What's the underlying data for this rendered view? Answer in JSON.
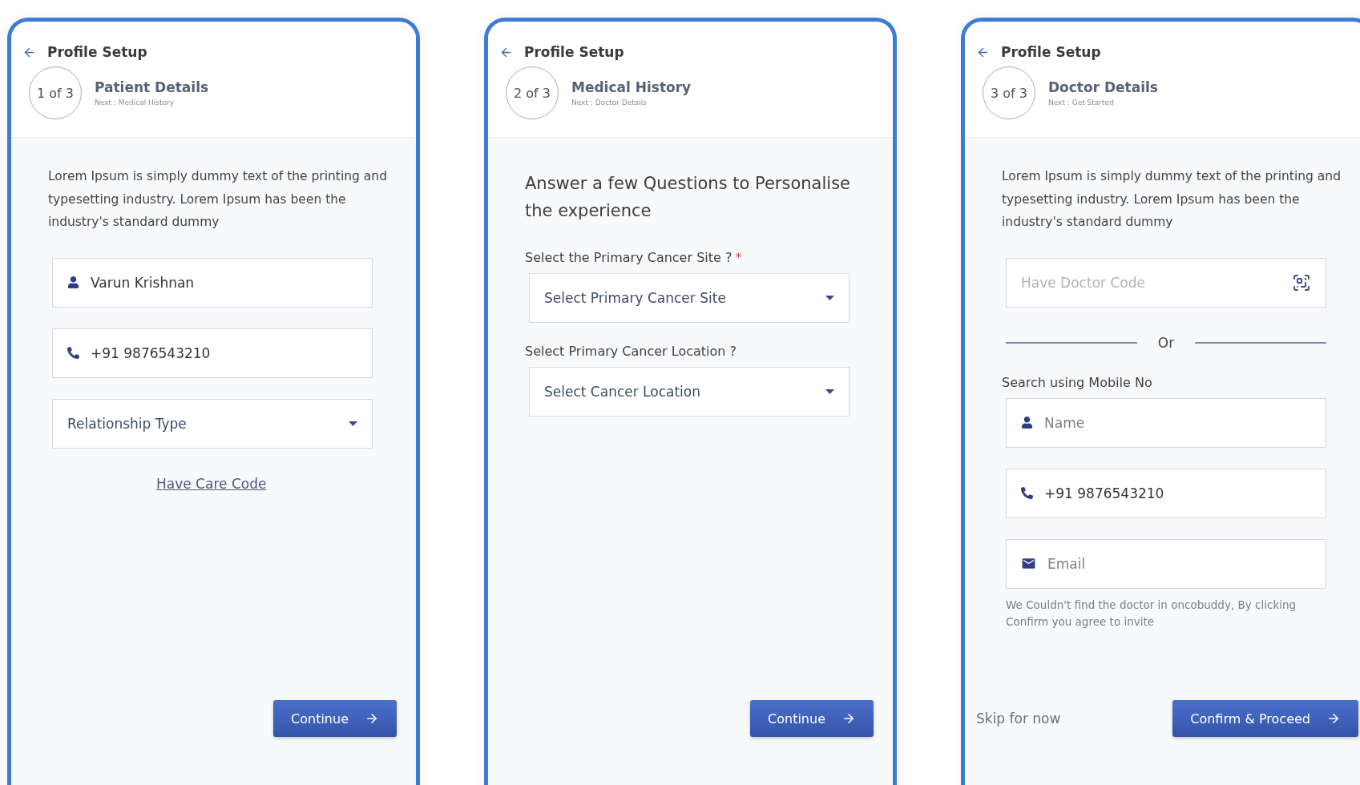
{
  "screens": [
    {
      "back_title": "Profile Setup",
      "step": {
        "label": "1 of 3",
        "title": "Patient Details",
        "next": "Next : Medical History"
      },
      "items": [
        {
          "kind": "paragraph",
          "text": "Lorem Ipsum is simply dummy text of the printing and typesetting industry. Lorem Ipsum has been the industry's standard dummy"
        },
        {
          "kind": "name",
          "value": "Varun Krishnan"
        },
        {
          "kind": "phone",
          "value": "+91 9876543210"
        },
        {
          "kind": "select",
          "value": "Relationship Type"
        },
        {
          "kind": "link",
          "text": "Have Care Code"
        }
      ],
      "footer": {
        "button": "Continue"
      }
    },
    {
      "back_title": "Profile Setup",
      "step": {
        "label": "2 of 3",
        "title": "Medical History",
        "next": "Next : Doctor Details"
      },
      "items": [
        {
          "kind": "heading",
          "text": "Answer a few Questions to Personalise the experience"
        },
        {
          "kind": "label",
          "text": "Select the Primary Cancer Site ?",
          "required_mark": "*"
        },
        {
          "kind": "select",
          "value": "Select Primary Cancer Site"
        },
        {
          "kind": "label",
          "text": "Select Primary Cancer Location ?"
        },
        {
          "kind": "select",
          "value": "Select Cancer Location"
        }
      ],
      "footer": {
        "button": "Continue"
      }
    },
    {
      "back_title": "Profile Setup",
      "step": {
        "label": "3 of 3",
        "title": "Doctor Details",
        "next": "Next : Get Started"
      },
      "items": [
        {
          "kind": "paragraph",
          "text": "Lorem Ipsum is simply dummy text of the printing and typesetting industry. Lorem Ipsum has been the industry's standard dummy"
        },
        {
          "kind": "code",
          "placeholder": "Have Doctor Code"
        },
        {
          "kind": "divider",
          "text": "Or"
        },
        {
          "kind": "label",
          "text": "Search using Mobile No"
        },
        {
          "kind": "name",
          "placeholder": "Name"
        },
        {
          "kind": "phone",
          "value": "+91 9876543210"
        },
        {
          "kind": "email",
          "placeholder": "Email"
        },
        {
          "kind": "note",
          "text": "We Couldn't find the doctor in oncobuddy, By clicking Confirm you agree to invite"
        }
      ],
      "footer": {
        "skip": "Skip for now",
        "button": "Confirm & Proceed"
      }
    }
  ]
}
